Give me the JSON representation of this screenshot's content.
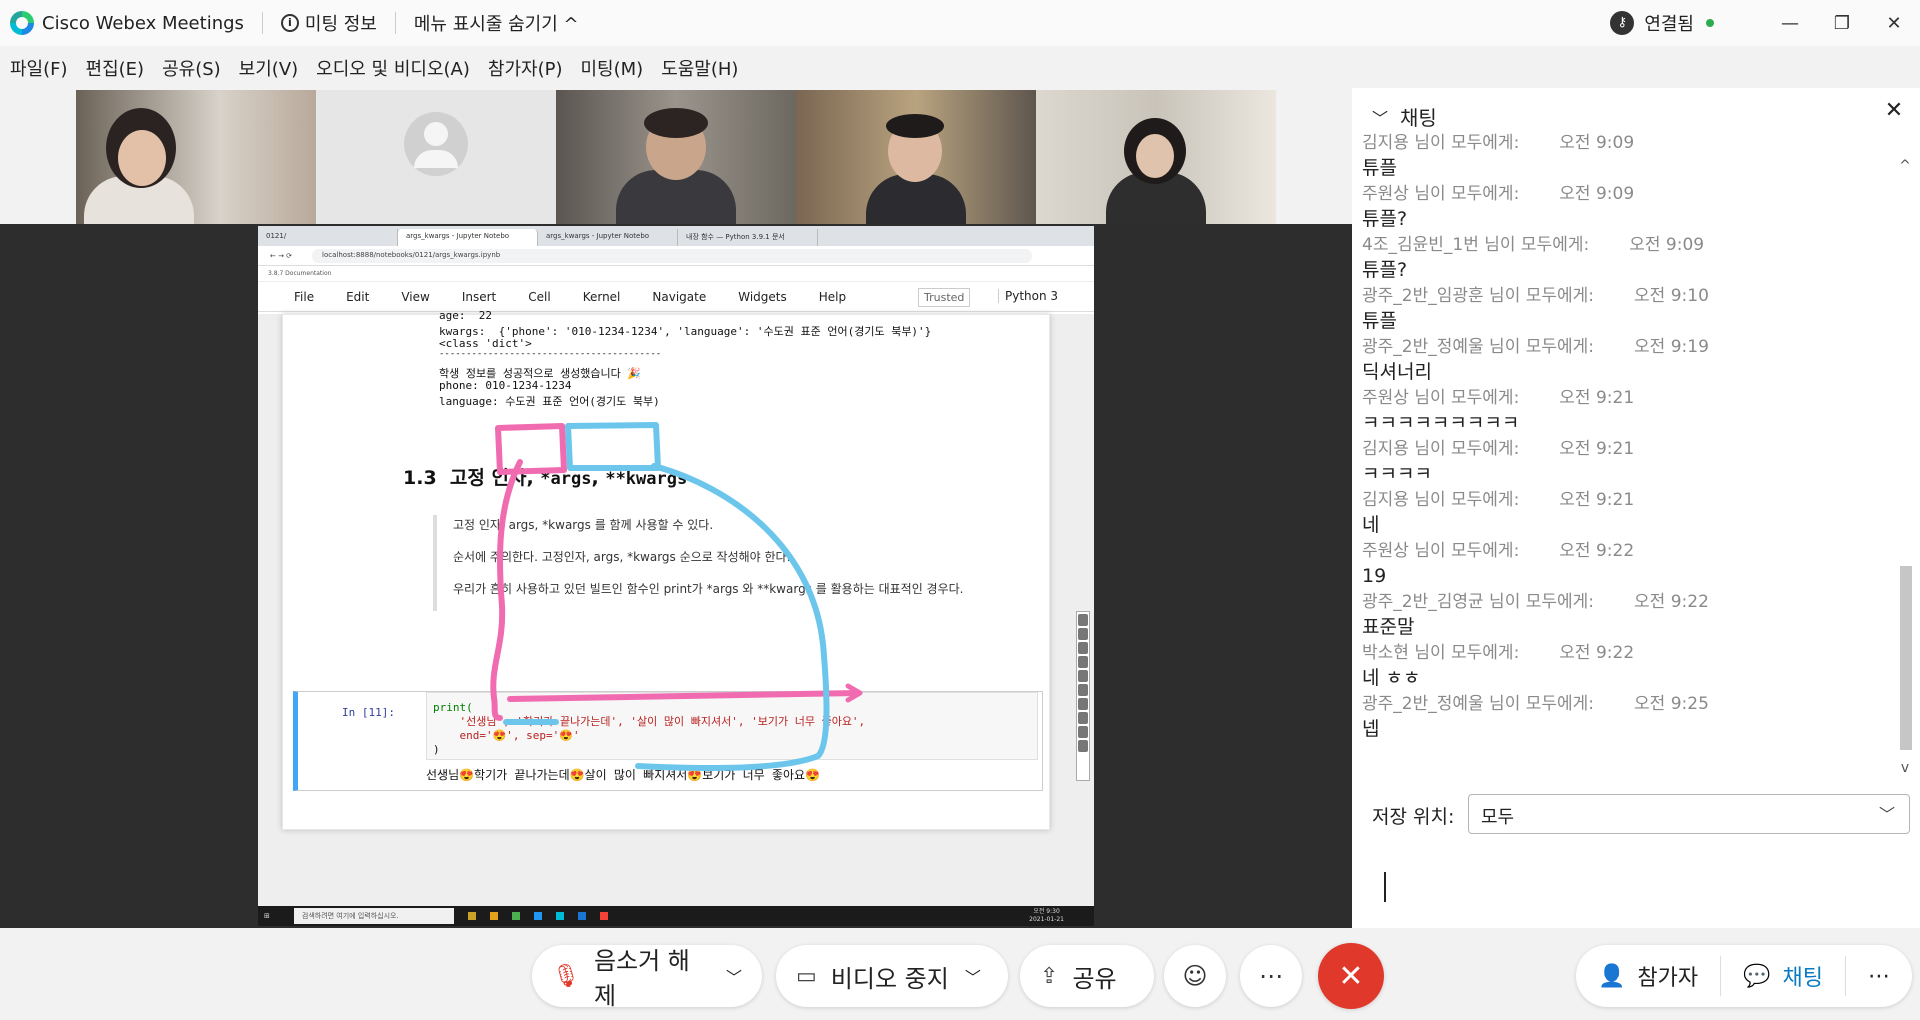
{
  "titlebar": {
    "app_title": "Cisco Webex Meetings",
    "meeting_info": "미팅 정보",
    "menu_toggle": "메뉴 표시줄 숨기기 ^",
    "connection": "연결됨",
    "minimize": "—",
    "restore": "❐",
    "close": "✕"
  },
  "menubar": [
    "파일(F)",
    "편집(E)",
    "공유(S)",
    "보기(V)",
    "오디오 및 비디오(A)",
    "참가자(P)",
    "미팅(M)",
    "도움말(H)"
  ],
  "thumbnails": [
    {
      "type": "video",
      "active": false
    },
    {
      "type": "avatar",
      "active": false
    },
    {
      "type": "video",
      "active": true
    },
    {
      "type": "video",
      "active": false
    },
    {
      "type": "video",
      "active": false
    }
  ],
  "shared_screen": {
    "browser_tabs": [
      "0121/",
      "args_kwargs - Jupyter Notebo",
      "args_kwargs - Jupyter Notebo",
      "내장 함수 — Python 3.9.1 문서"
    ],
    "url": "localhost:8888/notebooks/0121/args_kwargs.ipynb",
    "bookmark": "3.8.7 Documentation",
    "notebook_menu": [
      "File",
      "Edit",
      "View",
      "Insert",
      "Cell",
      "Kernel",
      "Navigate",
      "Widgets",
      "Help"
    ],
    "trusted": "Trusted",
    "kernel": "Python 3",
    "output_lines": [
      "age:  22",
      "kwargs:  {'phone': '010-1234-1234', 'language': '수도권 표준 언어(경기도 북부)'}",
      "<class 'dict'>",
      "-----------------------------------------",
      "학생 정보를 성공적으로 생성했습니다 🎉",
      "phone: 010-1234-1234",
      "language: 수도권 표준 언어(경기도 북부)"
    ],
    "heading_num": "1.3",
    "heading_text": "고정 인자,",
    "heading_args": "*args",
    "heading_comma": ",",
    "heading_kwargs": "**kwargs",
    "quote": [
      "고정 인자, args, *kwargs 를 함께 사용할 수 있다.",
      "순서에 주의한다. 고정인자, args, *kwargs 순으로 작성해야 한다.",
      "우리가 흔히 사용하고 있던 빌트인 함수인 print가 *args 와 **kwargs 를 활용하는 대표적인 경우다."
    ],
    "cell_prompt": "In [11]:",
    "code_lines": [
      "print(",
      "    '선생님', '학기가 끝나가는데', '살이 많이 빠지셔서', '보기가 너무 좋아요',",
      "    end='😍', sep='😍'",
      ")"
    ],
    "cell_output": "선생님😍학기가 끝나가는데😍살이 많이 빠지셔서😍보기가 너무 좋아요😍",
    "taskbar_search": "검색하려면 여기에 입력하십시오.",
    "taskbar_time": "오전 9:30",
    "taskbar_date": "2021-01-21"
  },
  "chat": {
    "title": "채팅",
    "messages": [
      {
        "from": "김지용 님이 모두에게:",
        "time": "오전 9:09",
        "text": "튜플"
      },
      {
        "from": "주원상 님이 모두에게:",
        "time": "오전 9:09",
        "text": "튜플?"
      },
      {
        "from": "4조_김윤빈_1번 님이 모두에게:",
        "time": "오전 9:09",
        "text": "튜플?"
      },
      {
        "from": "광주_2반_임광훈 님이 모두에게:",
        "time": "오전 9:10",
        "text": "튜플"
      },
      {
        "from": "광주_2반_정예울 님이 모두에게:",
        "time": "오전 9:19",
        "text": "딕셔너리"
      },
      {
        "from": "주원상 님이 모두에게:",
        "time": "오전 9:21",
        "text": "ㅋㅋㅋㅋㅋㅋㅋㅋㅋ"
      },
      {
        "from": "김지용 님이 모두에게:",
        "time": "오전 9:21",
        "text": "ㅋㅋㅋㅋ"
      },
      {
        "from": "김지용 님이 모두에게:",
        "time": "오전 9:21",
        "text": "네"
      },
      {
        "from": "주원상 님이 모두에게:",
        "time": "오전 9:22",
        "text": "19"
      },
      {
        "from": "광주_2반_김영균 님이 모두에게:",
        "time": "오전 9:22",
        "text": "표준말"
      },
      {
        "from": "박소현 님이 모두에게:",
        "time": "오전 9:22",
        "text": "네 ㅎㅎ"
      },
      {
        "from": "광주_2반_정예울 님이 모두에게:",
        "time": "오전 9:25",
        "text": "넵"
      }
    ],
    "save_label": "저장 위치:",
    "save_value": "모두"
  },
  "controls": {
    "unmute": "음소거 해제",
    "stop_video": "비디오 중지",
    "share": "공유",
    "participants": "참가자",
    "chat": "채팅"
  },
  "colors": {
    "accent_blue": "#00a0e9",
    "end_red": "#e0392b",
    "annot_pink": "#f06bb0",
    "annot_blue": "#6cc6ec"
  }
}
